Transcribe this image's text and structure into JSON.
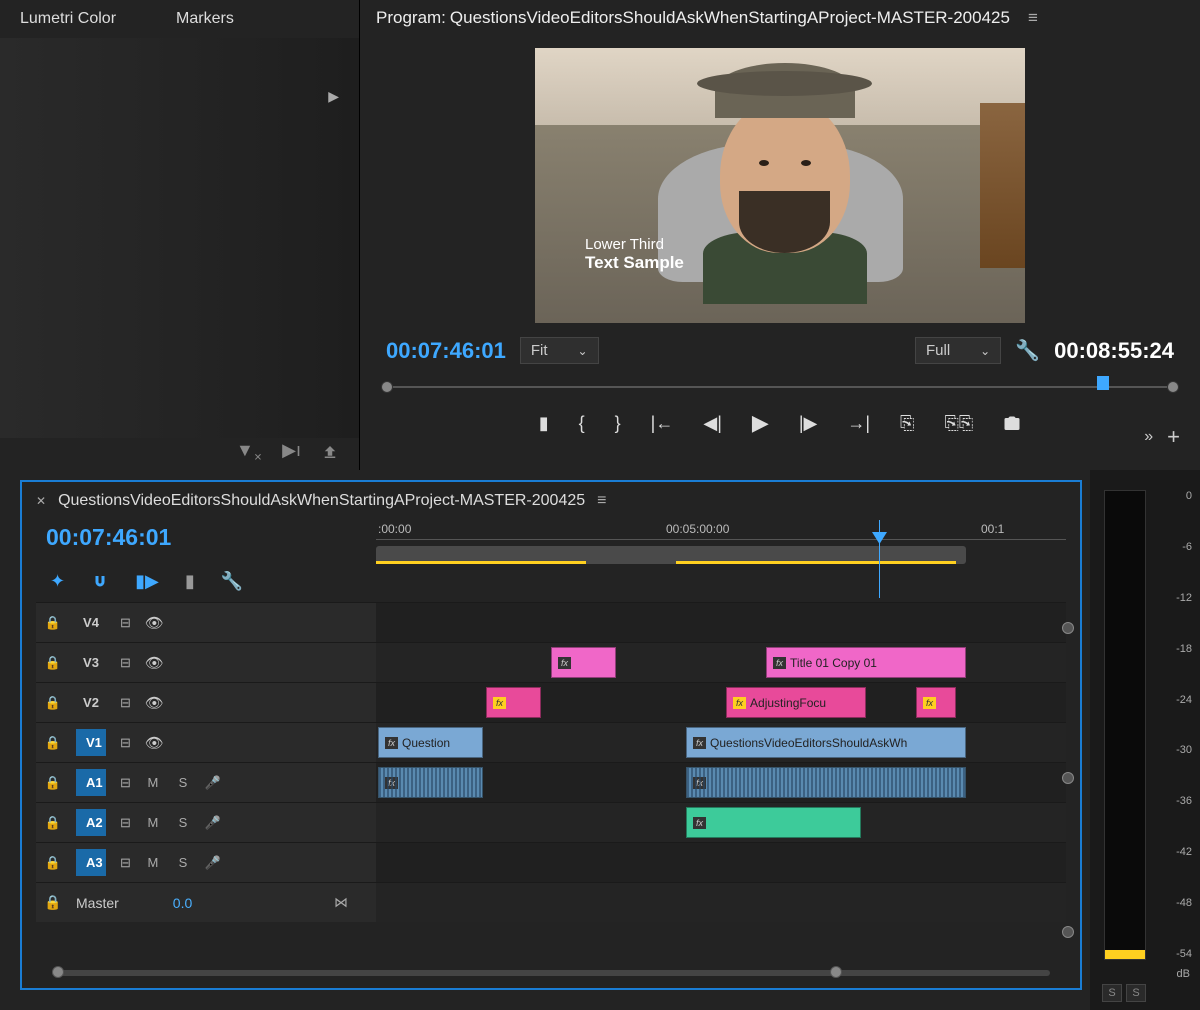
{
  "left_panel": {
    "tabs": [
      "Lumetri Color",
      "Markers"
    ]
  },
  "program": {
    "title_prefix": "Program: ",
    "sequence_name": "QuestionsVideoEditorsShouldAskWhenStartingAProject-MASTER-200425",
    "lower_third_line1": "Lower Third",
    "lower_third_line2": "Text Sample",
    "current_time": "00:07:46:01",
    "zoom_dropdown": "Fit",
    "resolution_dropdown": "Full",
    "duration": "00:08:55:24"
  },
  "timeline": {
    "sequence_name": "QuestionsVideoEditorsShouldAskWhenStartingAProject-MASTER-200425",
    "current_time": "00:07:46:01",
    "ruler_labels": [
      ":00:00",
      "00:05:00:00",
      "00:1"
    ],
    "master_label": "Master",
    "master_volume": "0.0",
    "tracks": {
      "v4": "V4",
      "v3": "V3",
      "v2": "V2",
      "v1": "V1",
      "a1": "A1",
      "a2": "A2",
      "a3": "A3"
    },
    "mute_label": "M",
    "solo_label": "S",
    "clips": {
      "v3_title": "Title 01 Copy 01",
      "v2_adjust": "AdjustingFocu",
      "v1_question": "Question",
      "v1_main": "QuestionsVideoEditorsShouldAskWh"
    }
  },
  "audio_meter": {
    "scale": [
      "0",
      "-6",
      "-12",
      "-18",
      "-24",
      "-30",
      "-36",
      "-42",
      "-48",
      "-54"
    ],
    "unit": "dB",
    "solo": "S"
  }
}
